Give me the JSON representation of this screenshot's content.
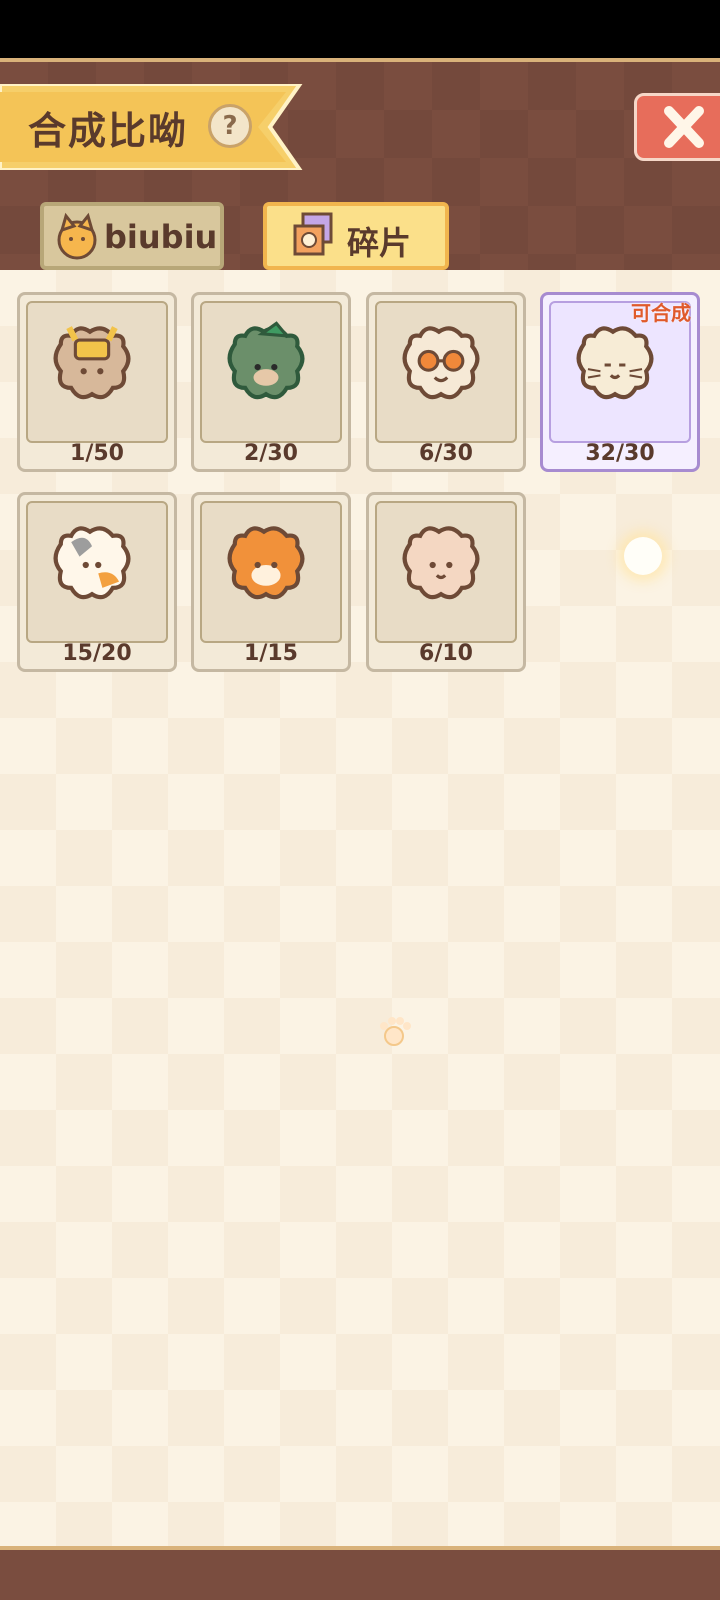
{
  "header": {
    "title": "合成比呦",
    "help_label": "?",
    "close_label": "close"
  },
  "tabs": [
    {
      "label": "biubiu"
    },
    {
      "label": "碎片"
    }
  ],
  "cards": [
    {
      "count": "1/50"
    },
    {
      "count": "2/30"
    },
    {
      "count": "6/30"
    },
    {
      "count": "32/30",
      "badge": "可合成"
    },
    {
      "count": "15/20"
    },
    {
      "count": "1/15"
    },
    {
      "count": "6/10"
    }
  ],
  "colors": {
    "header_bg": "#7a4d3f",
    "content_bg": "#fbf3e4",
    "ready_badge": "#e05a2b",
    "close_btn": "#e76d5b"
  }
}
